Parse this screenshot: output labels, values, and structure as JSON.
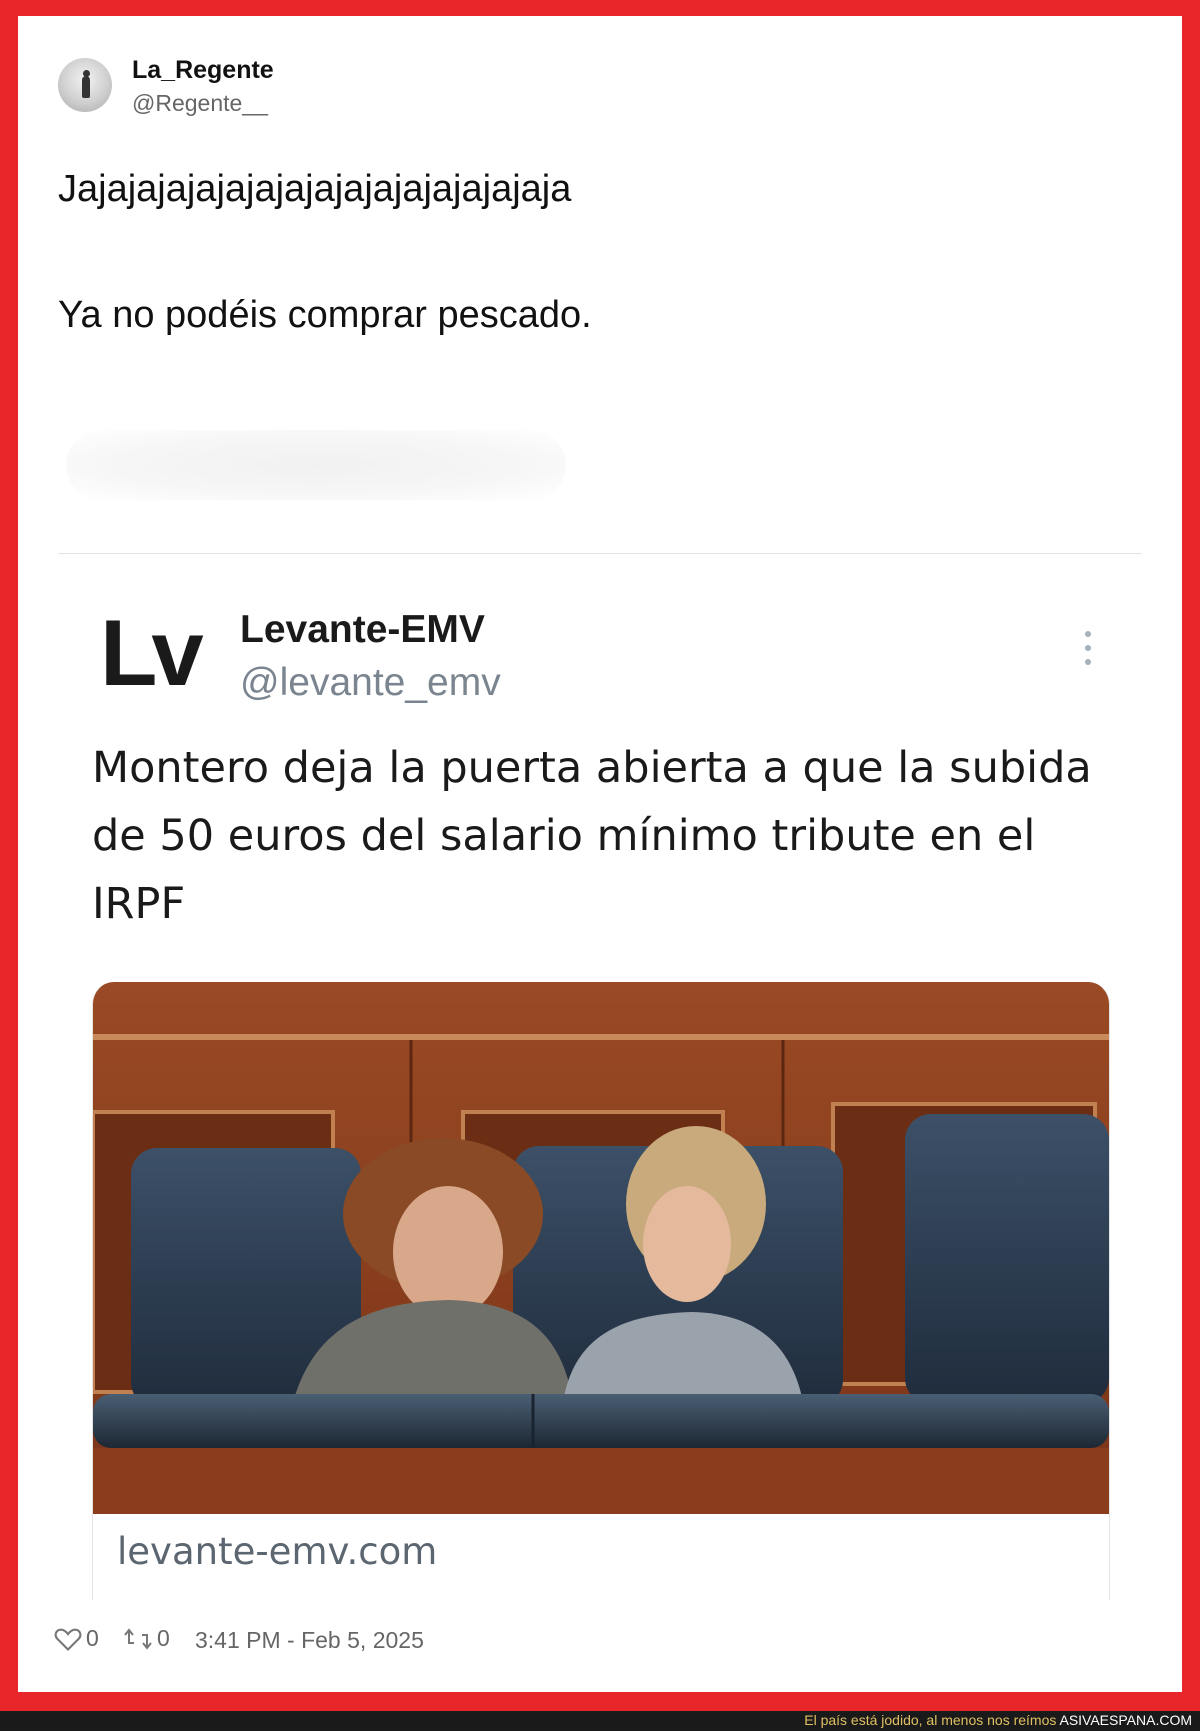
{
  "tweet": {
    "display_name": "La_Regente",
    "handle": "@Regente__",
    "line1": "Jajajajajajajajajajajajajajajajaja",
    "line2": "Ya no podéis comprar pescado.",
    "likes": "0",
    "retweets": "0",
    "timestamp": "3:41 PM - Feb 5, 2025"
  },
  "quoted": {
    "logo_text": "Lv",
    "display_name": "Levante-EMV",
    "handle": "@levante_emv",
    "headline": "Montero deja la puerta abierta a que la subida de 50 euros del salario mínimo tribute en el IRPF",
    "link_domain": "levante-emv.com",
    "photo_icon": "news-photo-parliament-bench"
  },
  "footer": {
    "tagline": "El país está jodido, al menos nos reímos ",
    "site": "ASIVAESPANA.COM"
  },
  "colors": {
    "border": "#e8262a",
    "footer_bg": "#1a1a1a",
    "footer_text": "#e0c060"
  }
}
